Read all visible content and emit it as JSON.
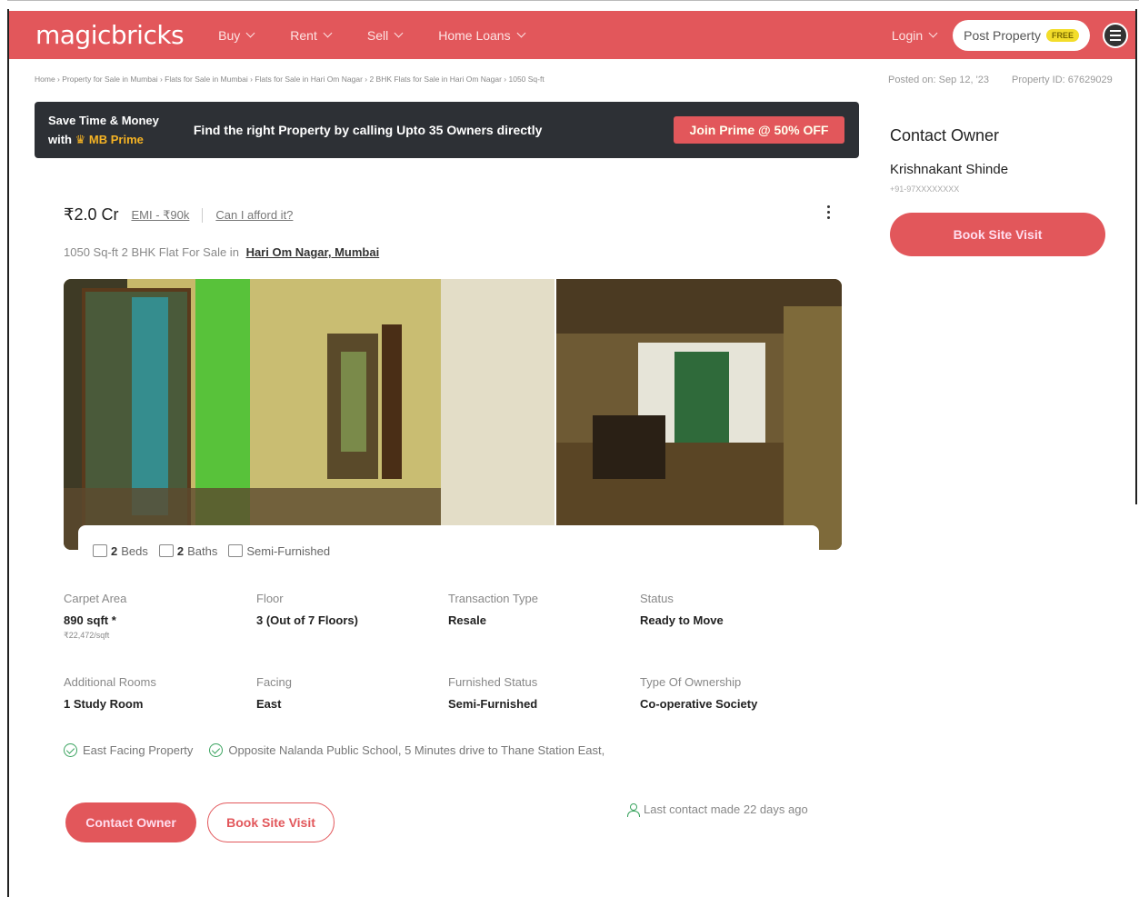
{
  "header": {
    "logo": "magicbricks",
    "nav": [
      {
        "label": "Buy"
      },
      {
        "label": "Rent"
      },
      {
        "label": "Sell"
      },
      {
        "label": "Home Loans"
      }
    ],
    "login": "Login",
    "post_property": "Post Property",
    "free_badge": "FREE"
  },
  "breadcrumb": "Home › Property for Sale in Mumbai › Flats for Sale in Mumbai › Flats for Sale in Hari Om Nagar › 2 BHK Flats for Sale in Hari Om Nagar › 1050 Sq-ft",
  "meta": {
    "posted_on": "Posted on: Sep 12, '23",
    "property_id": "Property ID: 67629029"
  },
  "prime_banner": {
    "line1": "Save Time & Money",
    "line2_prefix": "with",
    "line2_brand": "MB Prime",
    "message": "Find the right Property by calling Upto 35 Owners directly",
    "cta": "Join Prime @ 50% OFF"
  },
  "listing": {
    "price": "₹2.0 Cr",
    "emi": "EMI - ₹90k",
    "afford": "Can I afford it?",
    "subtitle_prefix": "1050 Sq-ft 2 BHK Flat For Sale in",
    "location": "Hari Om Nagar, Mumbai"
  },
  "amenities": {
    "beds_count": "2",
    "beds_label": "Beds",
    "baths_count": "2",
    "baths_label": "Baths",
    "furnishing": "Semi-Furnished"
  },
  "specs": [
    {
      "label": "Carpet Area",
      "value": "890 sqft *",
      "sub": "₹22,472/sqft"
    },
    {
      "label": "Floor",
      "value": "3 (Out of 7 Floors)"
    },
    {
      "label": "Transaction Type",
      "value": "Resale"
    },
    {
      "label": "Status",
      "value": "Ready to Move"
    },
    {
      "label": "Additional Rooms",
      "value": "1 Study Room"
    },
    {
      "label": "Facing",
      "value": "East"
    },
    {
      "label": "Furnished Status",
      "value": "Semi-Furnished"
    },
    {
      "label": "Type Of Ownership",
      "value": "Co-operative Society"
    }
  ],
  "features": [
    "East Facing Property",
    "Opposite Nalanda Public School, 5 Minutes drive to Thane Station East,"
  ],
  "actions": {
    "contact_owner": "Contact Owner",
    "book_site_visit": "Book Site Visit",
    "last_contact": "Last contact made 22 days ago"
  },
  "sidebar": {
    "title": "Contact Owner",
    "owner_name": "Krishnakant Shinde",
    "phone": "+91-97XXXXXXXX",
    "button": "Book Site Visit"
  },
  "colors": {
    "brand": "#e2575b",
    "banner_dark": "#2d3035",
    "prime_gold": "#f5b324",
    "check_green": "#3aa35f"
  }
}
